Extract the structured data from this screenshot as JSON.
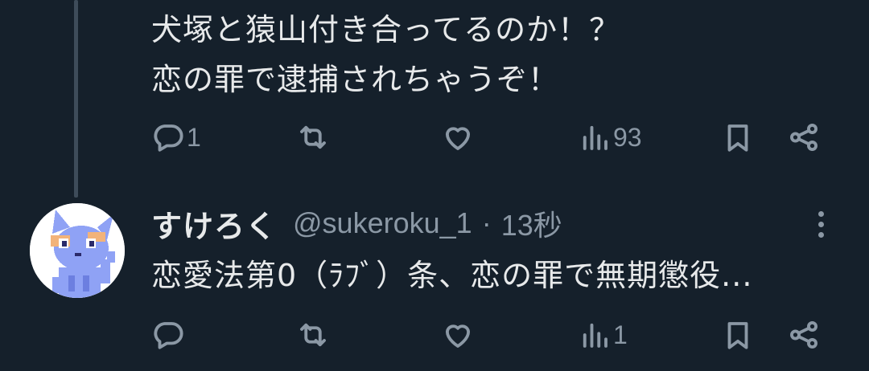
{
  "tweet1": {
    "lines": [
      "犬塚と猿山付き合ってるのか！？",
      "恋の罪で逮捕されちゃうぞ！"
    ],
    "actions": {
      "reply_count": "1",
      "retweet_count": "",
      "like_count": "",
      "views_count": "93"
    }
  },
  "tweet2": {
    "display_name": "すけろく",
    "handle": "@sukeroku_1",
    "separator": "·",
    "time": "13秒",
    "text": "恋愛法第0（ﾗﾌﾞ）条、恋の罪で無期懲役...",
    "actions": {
      "reply_count": "",
      "retweet_count": "",
      "like_count": "",
      "views_count": "1"
    }
  },
  "icons": [
    "reply-icon",
    "retweet-icon",
    "like-icon",
    "views-icon",
    "bookmark-icon",
    "share-icon",
    "more-icon"
  ],
  "colors": {
    "background": "#15202b",
    "text": "#e7e9ea",
    "secondary": "#8b98a5",
    "thread_line": "#3e4c5a",
    "avatar_cat": "#8fa2f5"
  }
}
